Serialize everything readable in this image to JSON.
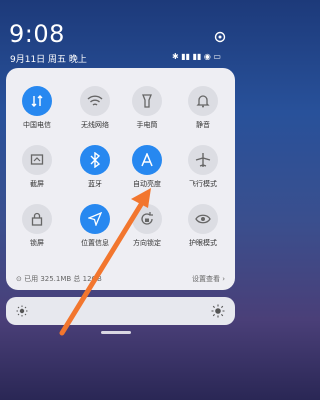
{
  "status": {
    "time": "9:08",
    "date": "9月11日 周五 晚上",
    "icons": "✱ ▮▮ ▮▮ ◉ ▭"
  },
  "tiles": [
    {
      "label": "中国电信",
      "icon": "data-icon",
      "on": true
    },
    {
      "label": "无线网络",
      "icon": "wifi-icon",
      "on": false
    },
    {
      "label": "手电筒",
      "icon": "flashlight-icon",
      "on": false
    },
    {
      "label": "静音",
      "icon": "bell-icon",
      "on": false
    },
    {
      "label": "截屏",
      "icon": "screenshot-icon",
      "on": false
    },
    {
      "label": "蓝牙",
      "icon": "bluetooth-icon",
      "on": true
    },
    {
      "label": "自动亮度",
      "icon": "auto-brightness-icon",
      "on": true
    },
    {
      "label": "飞行模式",
      "icon": "airplane-icon",
      "on": false
    },
    {
      "label": "锁屏",
      "icon": "lock-icon",
      "on": false
    },
    {
      "label": "位置信息",
      "icon": "location-icon",
      "on": true
    },
    {
      "label": "方向锁定",
      "icon": "rotation-lock-icon",
      "on": false
    },
    {
      "label": "护眼模式",
      "icon": "eye-icon",
      "on": false
    }
  ],
  "storage": {
    "left": "⊙ 已用 325.1MB 总 12GB",
    "right": "设置查看 ›"
  },
  "colors": {
    "accent": "#2788f0",
    "panel": "#eeeef3",
    "arrow": "#f2762e"
  }
}
